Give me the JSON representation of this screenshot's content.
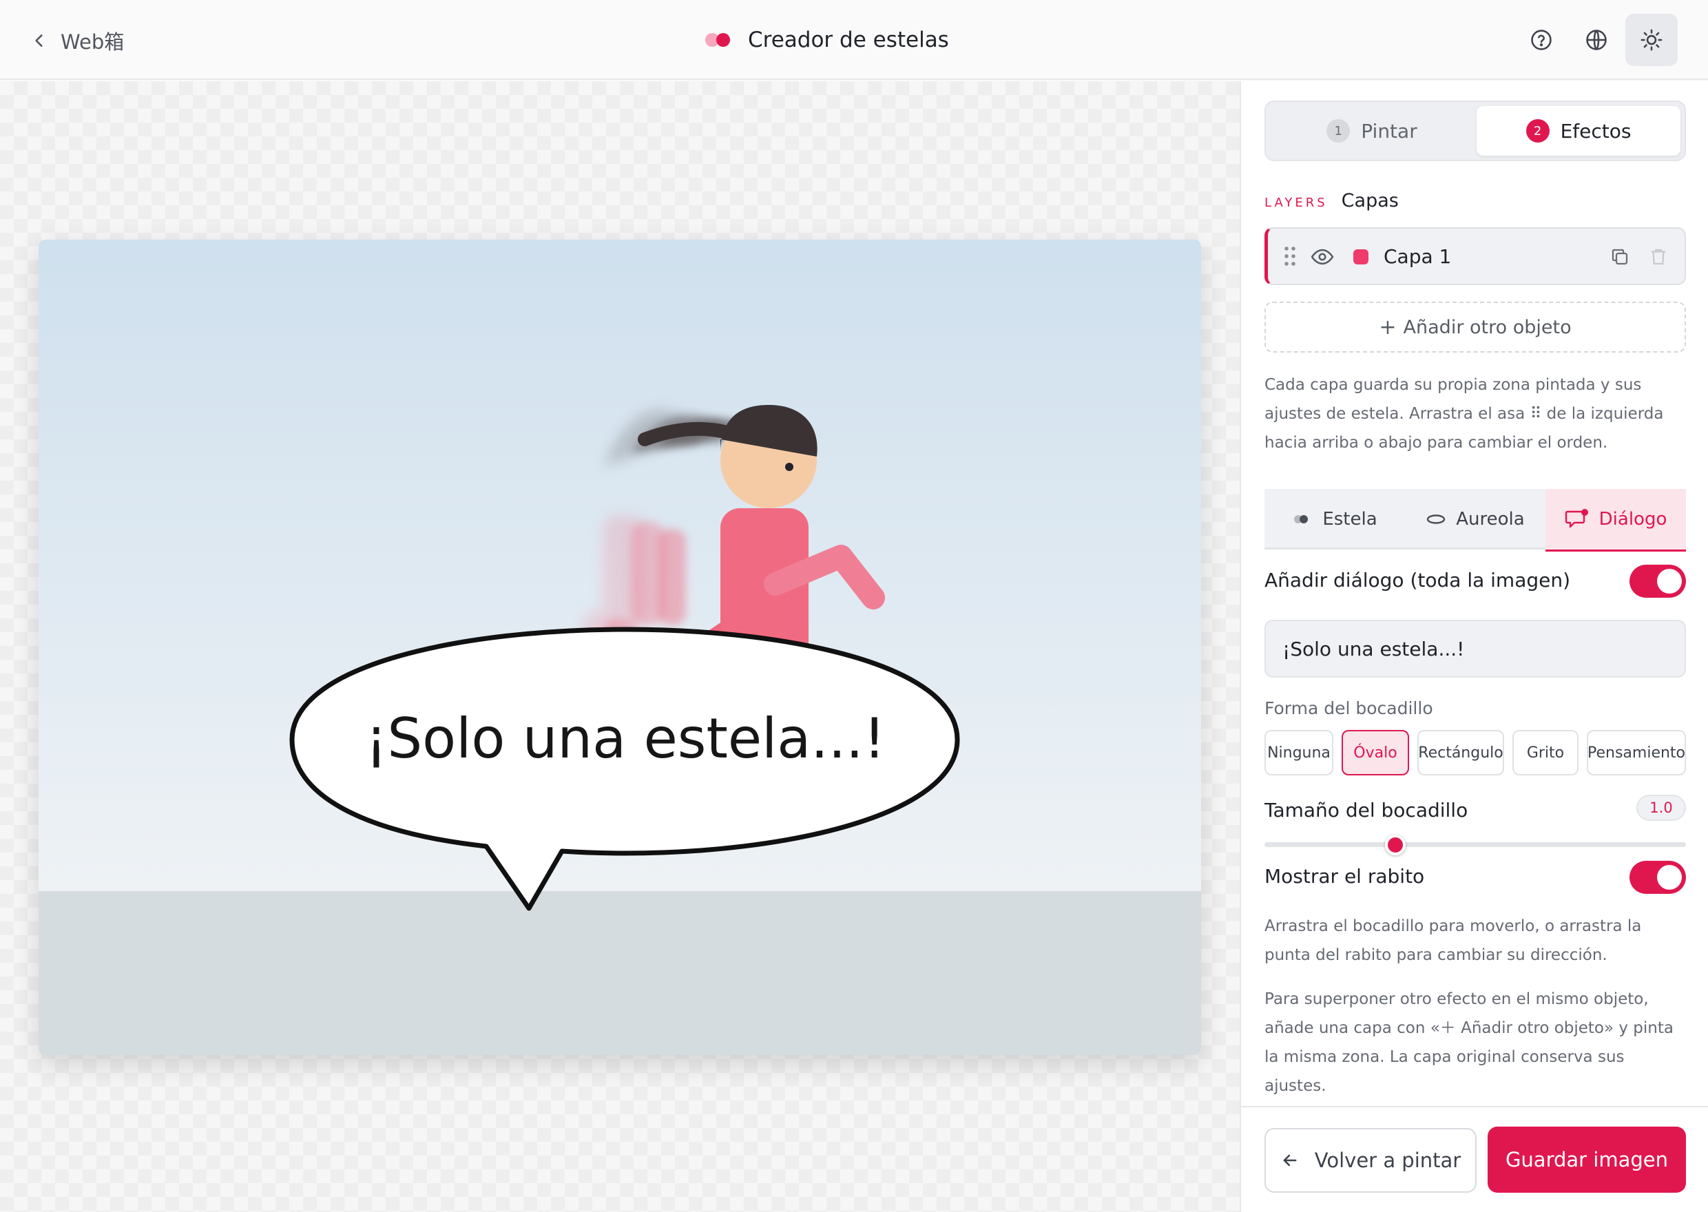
{
  "header": {
    "back_label": "Web箱",
    "app_title": "Creador de estelas",
    "logo_colors": [
      "#f7a6bb",
      "#e0174f"
    ],
    "actions": [
      {
        "icon": "help-circle-icon",
        "active": false
      },
      {
        "icon": "globe-icon",
        "active": false
      },
      {
        "icon": "sun-icon",
        "active": true
      }
    ]
  },
  "canvas": {
    "speech_text": "¡Solo una estela...!",
    "sky_color": "#d4e3f0",
    "ground_color": "#d5dcdf"
  },
  "panel": {
    "steps": [
      {
        "number": "1",
        "label": "Pintar",
        "active": false
      },
      {
        "number": "2",
        "label": "Efectos",
        "active": true
      }
    ],
    "layers_tag": "LAYERS",
    "layers_title": "Capas",
    "layers": [
      {
        "name": "Capa 1",
        "color": "#f03a6b",
        "visible": true
      }
    ],
    "add_object_label": "Añadir otro objeto",
    "layers_note": "Cada capa guarda su propia zona pintada y sus ajustes de estela. Arrastra el asa ⠿ de la izquierda hacia arriba o abajo para cambiar el orden.",
    "effect_tabs": [
      {
        "label": "Estela",
        "icon": "trail-icon",
        "active": false
      },
      {
        "label": "Aureola",
        "icon": "halo-icon",
        "active": false
      },
      {
        "label": "Diálogo",
        "icon": "speech-bubble-icon",
        "active": true
      }
    ],
    "dialog": {
      "add_label": "Añadir diálogo (toda la imagen)",
      "add_enabled": true,
      "text_value": "¡Solo una estela...!",
      "shape_label": "Forma del bocadillo",
      "shapes": [
        "Ninguna",
        "Óvalo",
        "Rectángulo",
        "Grito",
        "Pensamiento"
      ],
      "selected_shape": "Óvalo",
      "size_label": "Tamaño del bocadillo",
      "size_value": "1.0",
      "size_slider_fraction": 0.31,
      "tail_label": "Mostrar el rabito",
      "tail_enabled": true,
      "drag_note": "Arrastra el bocadillo para moverlo, o arrastra la punta del rabito para cambiar su dirección.",
      "overlay_note": "Para superponer otro efecto en el mismo objeto, añade una capa con «＋ Añadir otro objeto» y pinta la misma zona. La capa original conserva sus ajustes."
    },
    "footer": {
      "back_label": "Volver a pintar",
      "save_label": "Guardar imagen"
    }
  },
  "accent_color": "#e0174f"
}
